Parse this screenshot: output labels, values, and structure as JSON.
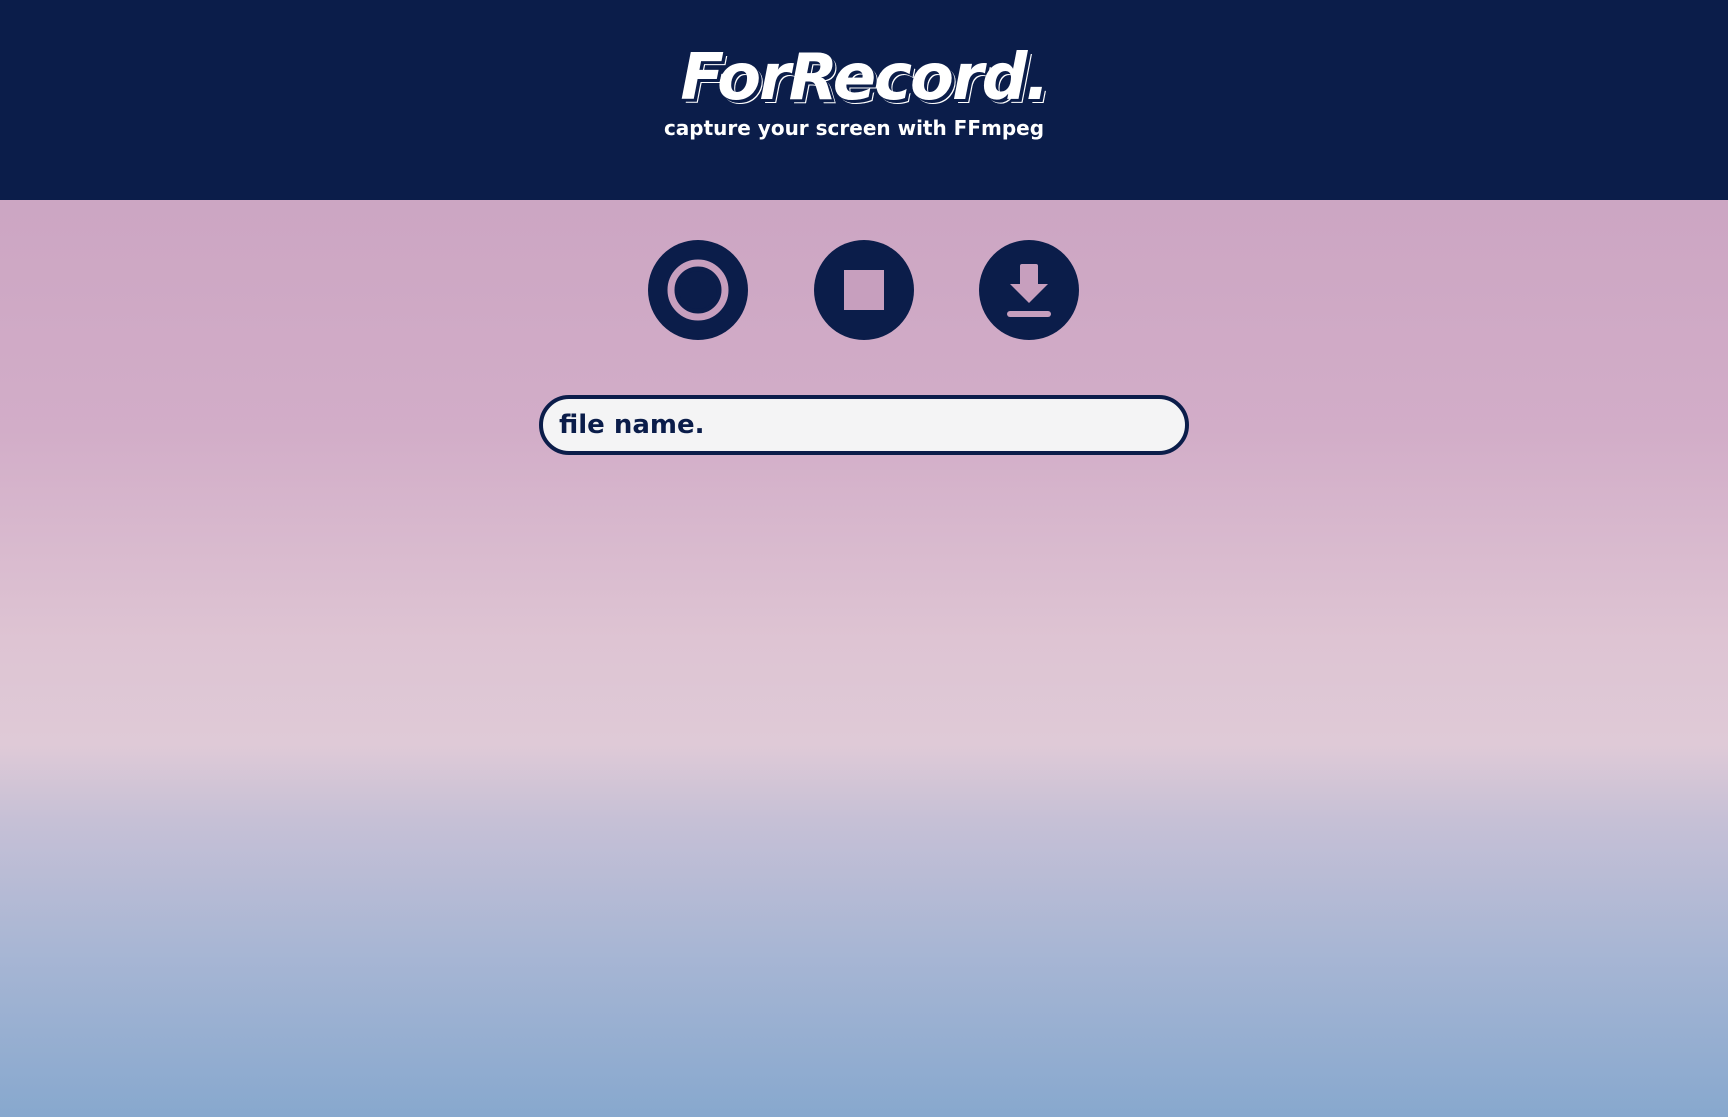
{
  "header": {
    "logo": "ForRecord.",
    "tagline": "capture your screen with FFmpeg"
  },
  "controls": [
    {
      "id": "record",
      "icon": "record-icon"
    },
    {
      "id": "stop",
      "icon": "stop-icon"
    },
    {
      "id": "download",
      "icon": "download-icon"
    }
  ],
  "filename": {
    "placeholder": "file name.",
    "value": ""
  },
  "colors": {
    "navy": "#0b1d4a",
    "pink_accent": "#c79fbe",
    "input_bg": "#f4f4f5"
  }
}
